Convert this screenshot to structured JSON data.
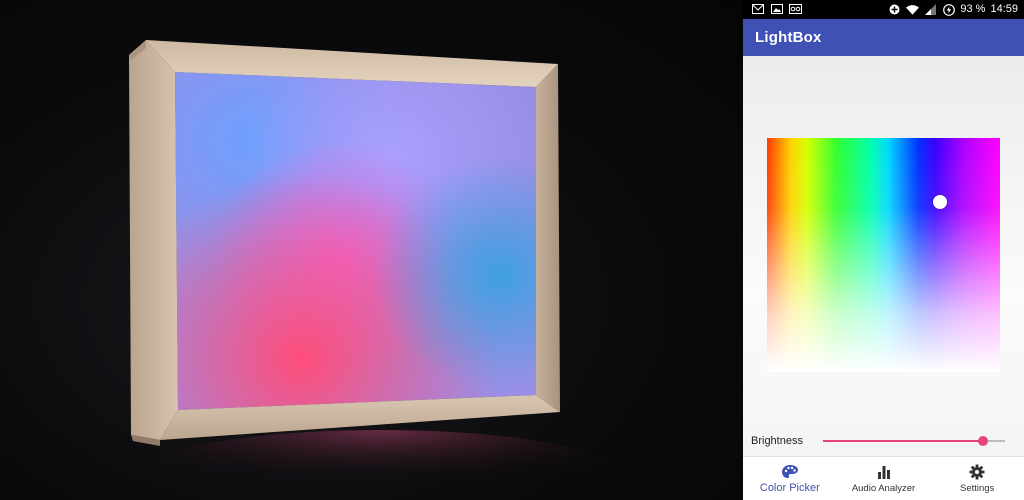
{
  "statusbar": {
    "left_icons": [
      "gmail-icon",
      "gallery-icon",
      "voicemail-icon"
    ],
    "battery_percent": "93 %",
    "time": "14:59"
  },
  "app": {
    "title": "LightBox",
    "accent_color": "#3f51b5",
    "slider_color": "#e84477"
  },
  "color_picker": {
    "selected_color": "#2a3bff"
  },
  "brightness": {
    "label": "Brightness",
    "value_fraction": 0.88
  },
  "bottom_nav": {
    "items": [
      {
        "label": "Color Picker",
        "icon": "palette-icon",
        "active": true
      },
      {
        "label": "Audio Analyzer",
        "icon": "bar-chart-icon",
        "active": false
      },
      {
        "label": "Settings",
        "icon": "gear-icon",
        "active": false
      }
    ]
  }
}
